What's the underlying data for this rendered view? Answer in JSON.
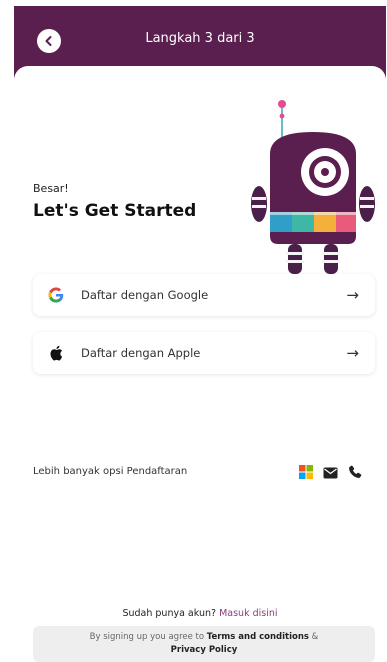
{
  "header": {
    "step_text": "Langkah 3 dari 3",
    "background": "#5a1f4f"
  },
  "greeting": {
    "small": "Besar!",
    "title": "Let's Get Started"
  },
  "signin_options": [
    {
      "icon": "google-icon",
      "label": "Daftar dengan Google"
    },
    {
      "icon": "apple-icon",
      "label": "Daftar dengan Apple"
    }
  ],
  "more_options": {
    "label": "Lebih banyak opsi Pendaftaran",
    "icons": [
      "microsoft-icon",
      "mail-icon",
      "phone-icon"
    ]
  },
  "terms": {
    "prefix": "By signing up you agree to",
    "terms_link": "Terms and conditions",
    "amp": "&",
    "privacy_link": "Privacy Policy"
  },
  "login": {
    "question": "Sudah punya akun?",
    "link": "Masuk disini"
  },
  "colors": {
    "brand": "#5a1f4f",
    "link": "#8a3d7e"
  }
}
